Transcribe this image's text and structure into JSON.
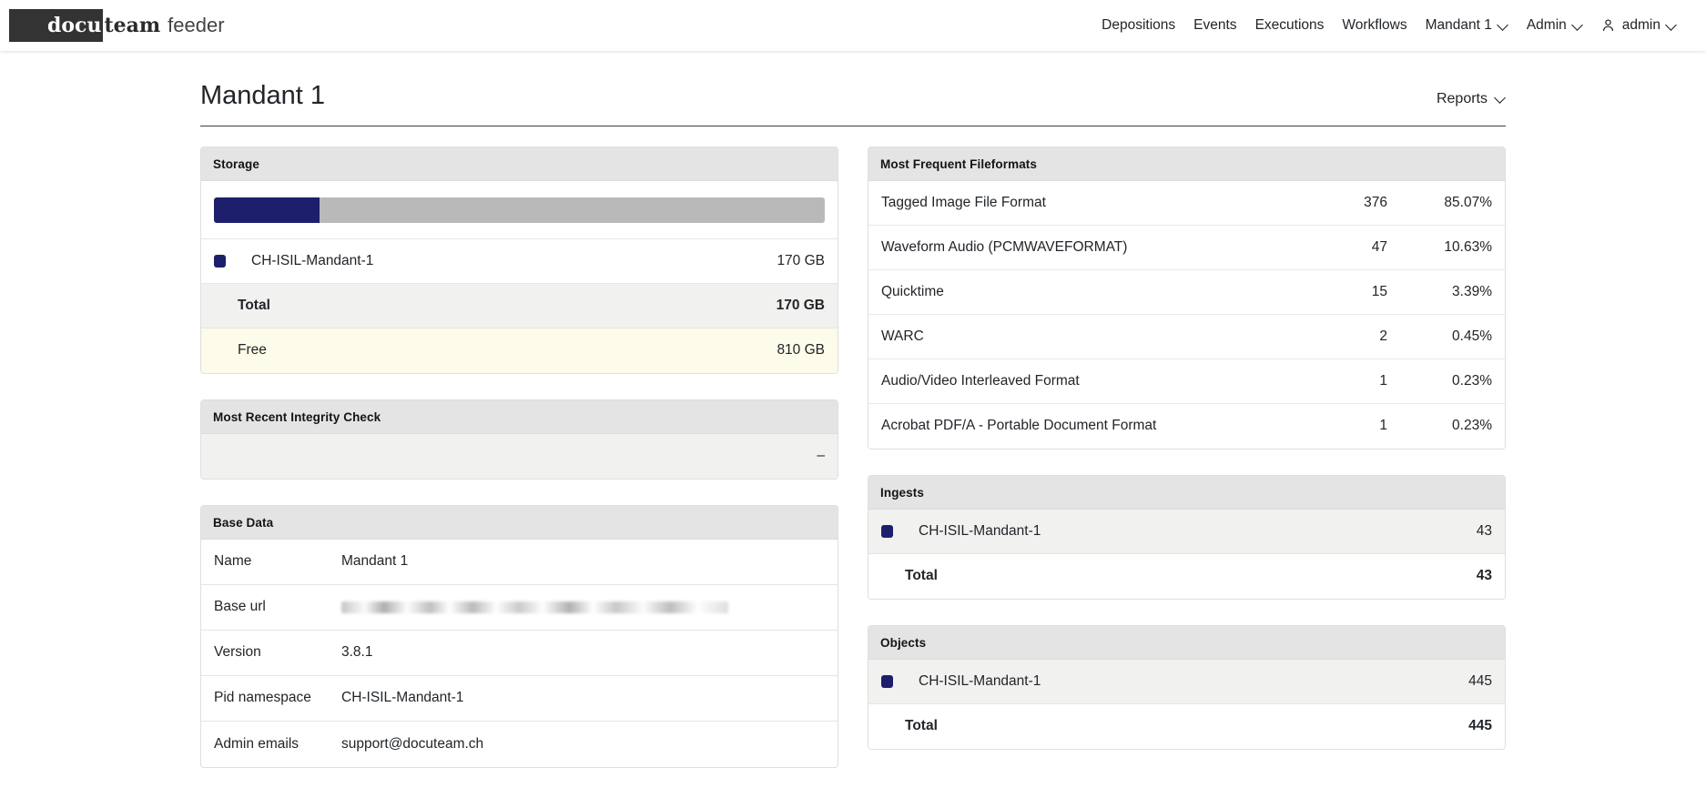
{
  "brand": {
    "box_text": "docu",
    "team_text": "team",
    "product_text": "feeder"
  },
  "navbar": {
    "links": [
      {
        "label": "Depositions",
        "has_caret": false,
        "icon": null
      },
      {
        "label": "Events",
        "has_caret": false,
        "icon": null
      },
      {
        "label": "Executions",
        "has_caret": false,
        "icon": null
      },
      {
        "label": "Workflows",
        "has_caret": false,
        "icon": null
      },
      {
        "label": "Mandant 1",
        "has_caret": true,
        "icon": "chevron-down-icon"
      },
      {
        "label": "Admin",
        "has_caret": true,
        "icon": "chevron-down-icon"
      },
      {
        "label": "admin",
        "has_caret": true,
        "icon": "person-icon"
      }
    ]
  },
  "page": {
    "title": "Mandant 1",
    "reports_label": "Reports"
  },
  "storage": {
    "header": "Storage",
    "accent_color": "#1d1f6d",
    "track_color": "#b9b9b9",
    "fill_percent": 17.3,
    "items": [
      {
        "label": "CH-ISIL-Mandant-1",
        "value": "170 GB",
        "swatch": "#1d1f6d"
      }
    ],
    "total_label": "Total",
    "total_value": "170 GB",
    "free_label": "Free",
    "free_value": "810 GB"
  },
  "integrity": {
    "header": "Most Recent Integrity Check",
    "value": "–"
  },
  "base_data": {
    "header": "Base Data",
    "rows": [
      {
        "key": "Name",
        "value": "Mandant 1",
        "redacted": false
      },
      {
        "key": "Base url",
        "value": "",
        "redacted": true
      },
      {
        "key": "Version",
        "value": "3.8.1",
        "redacted": false
      },
      {
        "key": "Pid namespace",
        "value": "CH-ISIL-Mandant-1",
        "redacted": false
      },
      {
        "key": "Admin emails",
        "value": "support@docuteam.ch",
        "redacted": false
      }
    ]
  },
  "fileformats": {
    "header": "Most Frequent Fileformats",
    "rows": [
      {
        "name": "Tagged Image File Format",
        "count": "376",
        "percent": "85.07%"
      },
      {
        "name": "Waveform Audio (PCMWAVEFORMAT)",
        "count": "47",
        "percent": "10.63%"
      },
      {
        "name": "Quicktime",
        "count": "15",
        "percent": "3.39%"
      },
      {
        "name": "WARC",
        "count": "2",
        "percent": "0.45%"
      },
      {
        "name": "Audio/Video Interleaved Format",
        "count": "1",
        "percent": "0.23%"
      },
      {
        "name": "Acrobat PDF/A - Portable Document Format",
        "count": "1",
        "percent": "0.23%"
      }
    ]
  },
  "ingests": {
    "header": "Ingests",
    "items": [
      {
        "label": "CH-ISIL-Mandant-1",
        "value": "43",
        "swatch": "#1d1f6d"
      }
    ],
    "total_label": "Total",
    "total_value": "43"
  },
  "objects": {
    "header": "Objects",
    "items": [
      {
        "label": "CH-ISIL-Mandant-1",
        "value": "445",
        "swatch": "#1d1f6d"
      }
    ],
    "total_label": "Total",
    "total_value": "445"
  }
}
